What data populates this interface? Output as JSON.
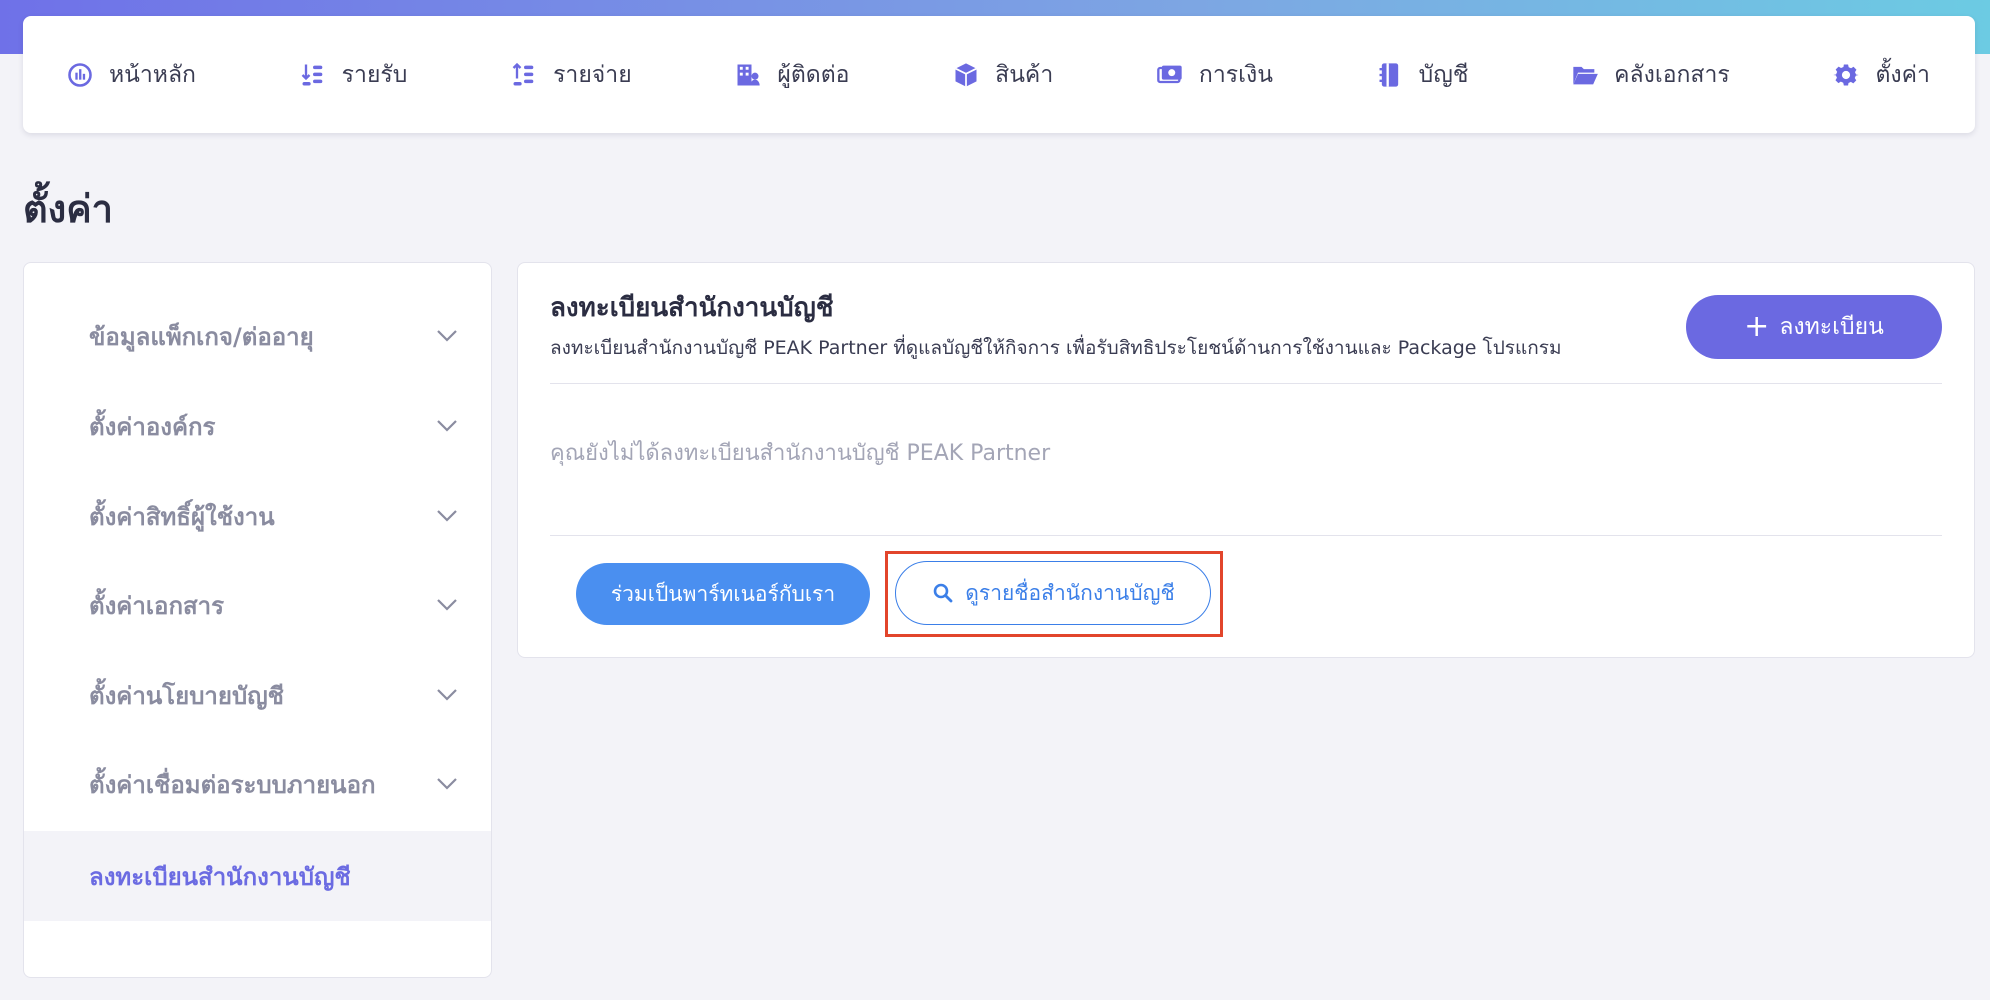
{
  "nav": {
    "items": [
      {
        "label": "หน้าหลัก",
        "icon": "dashboard-icon"
      },
      {
        "label": "รายรับ",
        "icon": "income-icon"
      },
      {
        "label": "รายจ่าย",
        "icon": "expense-icon"
      },
      {
        "label": "ผู้ติดต่อ",
        "icon": "contacts-icon"
      },
      {
        "label": "สินค้า",
        "icon": "product-box-icon"
      },
      {
        "label": "การเงิน",
        "icon": "money-icon"
      },
      {
        "label": "บัญชี",
        "icon": "ledger-icon"
      },
      {
        "label": "คลังเอกสาร",
        "icon": "folder-icon"
      },
      {
        "label": "ตั้งค่า",
        "icon": "gear-icon"
      }
    ],
    "accent_color": "#6b69e1"
  },
  "page": {
    "title": "ตั้งค่า"
  },
  "sidebar": {
    "items": [
      {
        "label": "ข้อมูลแพ็กเกจ/ต่ออายุ",
        "expandable": true
      },
      {
        "label": "ตั้งค่าองค์กร",
        "expandable": true
      },
      {
        "label": "ตั้งค่าสิทธิ์ผู้ใช้งาน",
        "expandable": true
      },
      {
        "label": "ตั้งค่าเอกสาร",
        "expandable": true
      },
      {
        "label": "ตั้งค่านโยบายบัญชี",
        "expandable": true
      },
      {
        "label": "ตั้งค่าเชื่อมต่อระบบภายนอก",
        "expandable": true
      },
      {
        "label": "ลงทะเบียนสำนักงานบัญชี",
        "expandable": false,
        "active": true
      }
    ]
  },
  "card": {
    "title": "ลงทะเบียนสำนักงานบัญชี",
    "description": "ลงทะเบียนสำนักงานบัญชี PEAK Partner ที่ดูแลบัญชีให้กิจการ เพื่อรับสิทธิประโยชน์ด้านการใช้งานและ Package โปรแกรม",
    "register_button_plus": "+",
    "register_button_label": "ลงทะเบียน",
    "empty_message": "คุณยังไม่ได้ลงทะเบียนสำนักงานบัญชี PEAK Partner",
    "join_button_label": "ร่วมเป็นพาร์ทเนอร์กับเรา",
    "browse_button_label": "ดูรายชื่อสำนักงานบัญชี"
  },
  "colors": {
    "primary_purple": "#6b69e1",
    "primary_blue": "#4a8ff0",
    "highlight_red": "#e2452b"
  }
}
